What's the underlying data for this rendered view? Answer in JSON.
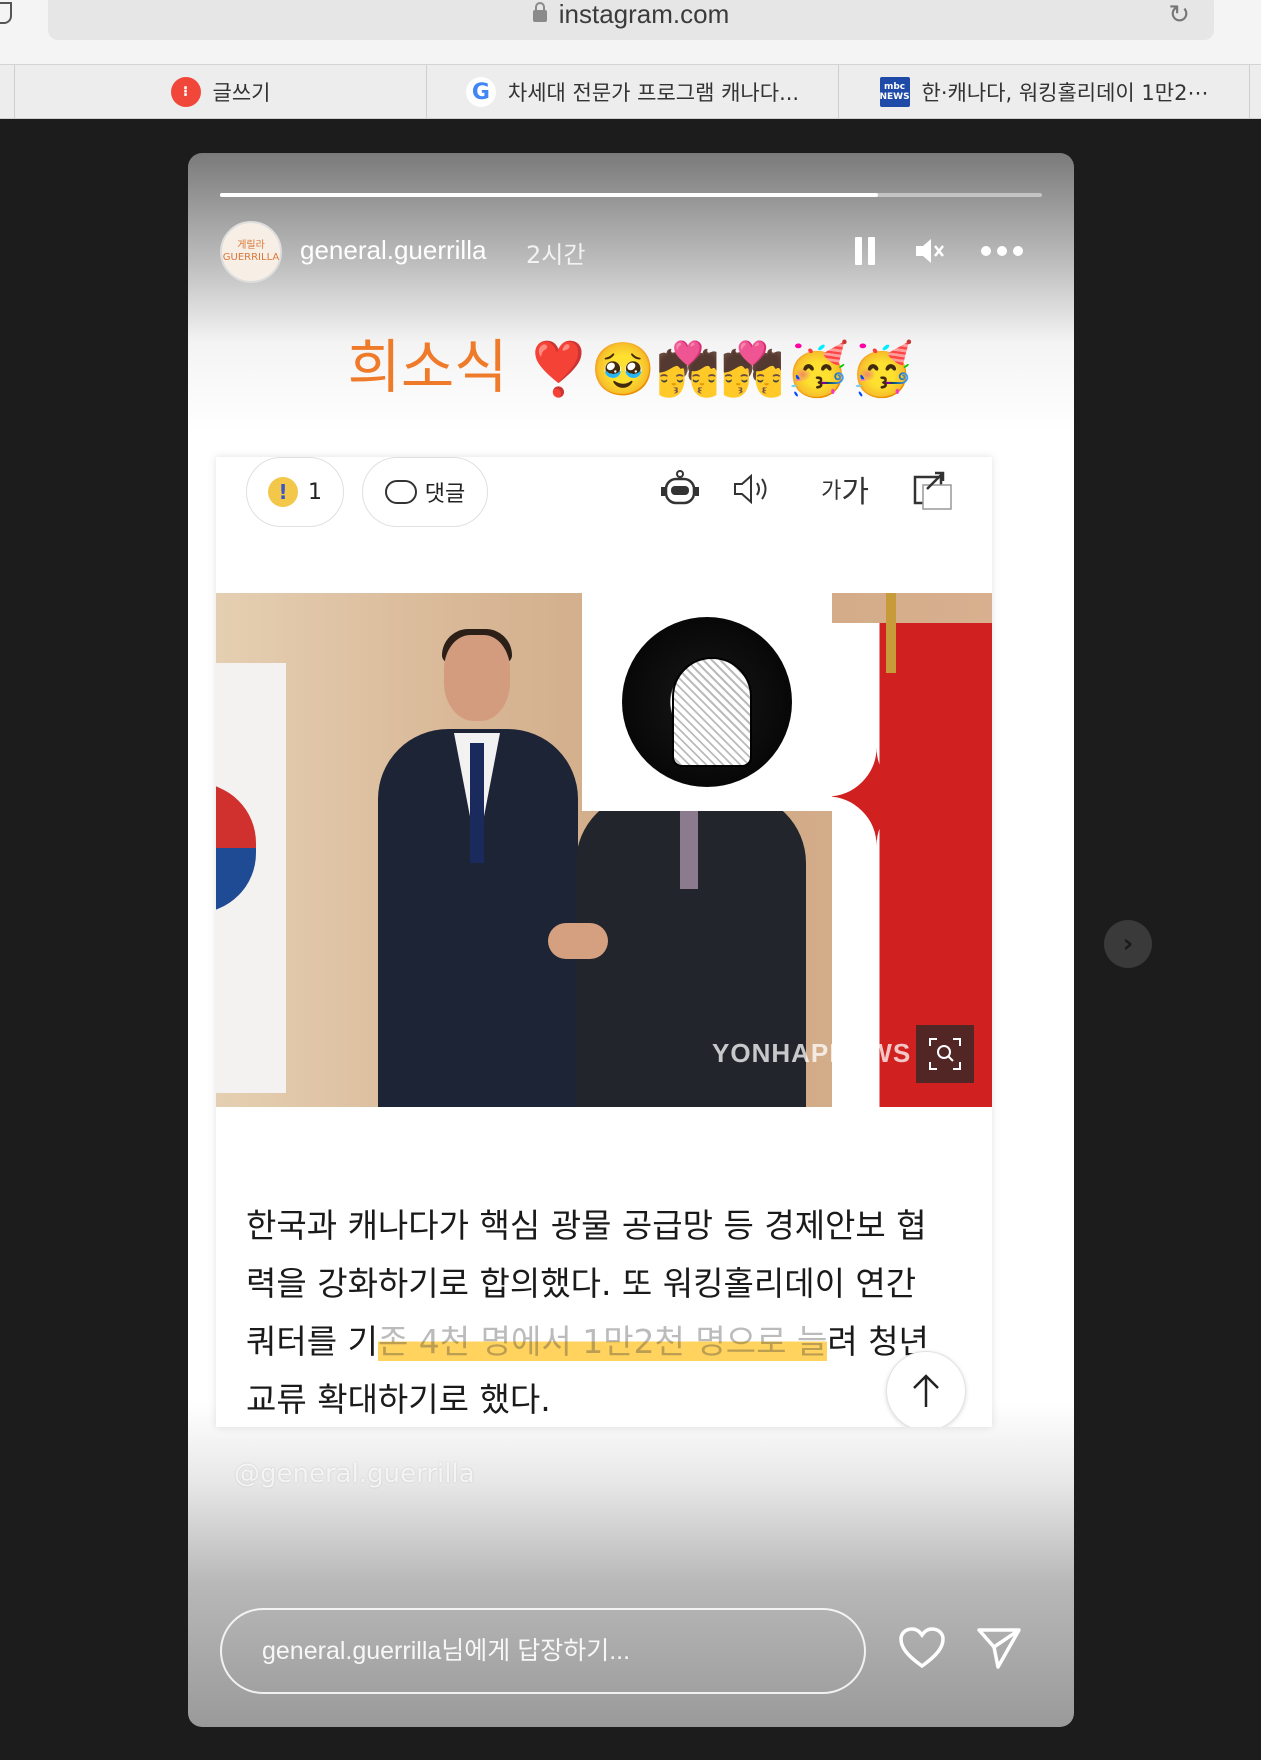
{
  "browser": {
    "url": "instagram.com",
    "tabs": [
      {
        "label": "글쓰기",
        "favicon": "brunch-icon"
      },
      {
        "label": "차세대 전문가 프로그램 캐나다...",
        "favicon": "google-icon"
      },
      {
        "label": "한·캐나다, 워킹홀리데이 1만2⋯",
        "favicon": "mbc-news-icon"
      }
    ]
  },
  "story": {
    "progress": 0.8,
    "username": "general.guerrilla",
    "avatar_text_top": "게릴라",
    "avatar_text_bottom": "GUERRILLA",
    "time_ago": "2시간",
    "headline_text": "희소식",
    "headline_emojis": "❣️🥹💏💏🥳🥳",
    "watermark_handle": "@general.guerrilla",
    "reply_placeholder": "general.guerrilla님에게 답장하기..."
  },
  "article": {
    "reaction_count": "1",
    "comment_label": "댓글",
    "font_label_small": "가",
    "font_label_big": "가",
    "image_watermark": "YONHAPNEWS",
    "body_line1": "한국과 캐나다가 핵심 광물 공급망 등 경제안보 협",
    "body_line2": "력을 강화하기로 합의했다. 또 워킹홀리데이 연간",
    "body_line3_pre": "쿼터를 기",
    "body_line3_hl": "존 4천 명에서 1만2천 명으로 늘",
    "body_line3_post": "려 청년",
    "body_line4": "교류 확대하기로 했다."
  },
  "colors": {
    "headline": "#ef7a2a",
    "highlight": "#ffc428",
    "page_bg": "#1c1c1c"
  }
}
